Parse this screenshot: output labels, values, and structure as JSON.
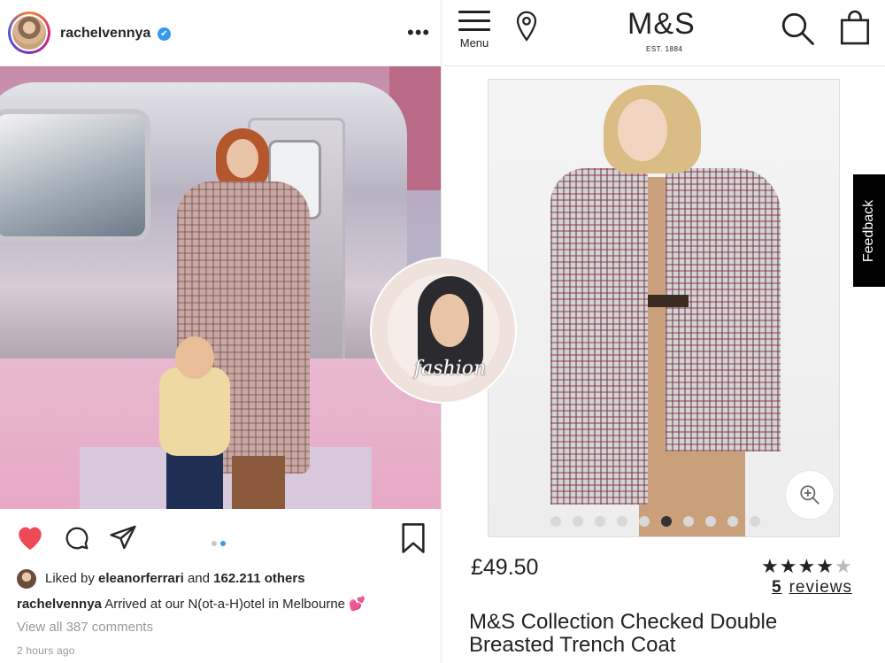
{
  "instagram": {
    "username": "rachelvennya",
    "verified_mark": "✔",
    "more_icon": "•••",
    "carousel": {
      "count": 2,
      "active_index": 1
    },
    "liked_by_prefix": "Liked by",
    "liked_by_user": "eleanorferrari",
    "liked_by_and": "and",
    "liked_by_count": "162.211 others",
    "caption_user": "rachelvennya",
    "caption_text": "Arrived at our N(ot-a-H)otel in Melbourne 💕",
    "view_comments": "View all 387 comments",
    "time_ago": "2 hours ago",
    "photo_overlay_text": "fashion",
    "heart_color": "#ed4956"
  },
  "ms": {
    "menu_label": "Menu",
    "logo": "M&S",
    "logo_est": "EST. 1884",
    "feedback_label": "Feedback",
    "carousel": {
      "count": 10,
      "active_index": 5
    },
    "price": "£49.50",
    "rating": {
      "stars_filled": 4,
      "stars_total": 5
    },
    "reviews_count": "5",
    "reviews_label": "reviews",
    "product_title": "M&S Collection Checked Double Breasted Trench Coat"
  }
}
